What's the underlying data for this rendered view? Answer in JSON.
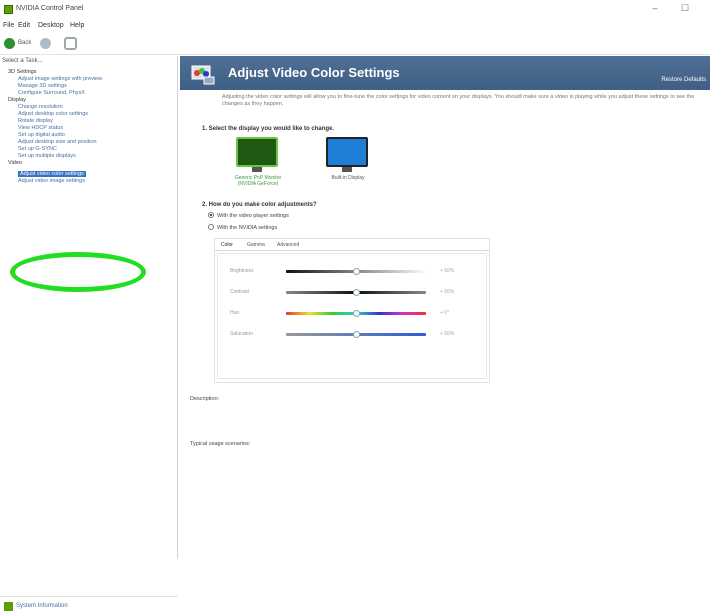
{
  "window": {
    "title": "NVIDIA Control Panel",
    "controls": [
      "–",
      "☐"
    ]
  },
  "menu": [
    "File",
    "Edit",
    "Desktop",
    "Help"
  ],
  "toolbar": {
    "back_label": "Back"
  },
  "sidebar": {
    "header": "Select a Task...",
    "items": [
      {
        "label": "3D Settings",
        "kind": "category"
      },
      {
        "label": "Adjust image settings with preview",
        "kind": "item"
      },
      {
        "label": "Manage 3D settings",
        "kind": "item"
      },
      {
        "label": "Configure Surround, PhysX",
        "kind": "item"
      },
      {
        "label": "Display",
        "kind": "category"
      },
      {
        "label": "Change resolution",
        "kind": "item"
      },
      {
        "label": "Adjust desktop color settings",
        "kind": "item"
      },
      {
        "label": "Rotate display",
        "kind": "item"
      },
      {
        "label": "View HDCP status",
        "kind": "item"
      },
      {
        "label": "Set up digital audio",
        "kind": "item"
      },
      {
        "label": "Adjust desktop size and position",
        "kind": "item"
      },
      {
        "label": "Set up G-SYNC",
        "kind": "item"
      },
      {
        "label": "Set up multiple displays",
        "kind": "item"
      },
      {
        "label": "Video",
        "kind": "category"
      },
      {
        "label": "Adjust video color settings",
        "kind": "selected"
      },
      {
        "label": "Adjust video image settings",
        "kind": "item"
      }
    ],
    "footer": "System Information"
  },
  "main": {
    "title": "Adjust Video Color Settings",
    "link": "Restore Defaults",
    "description": "Adjusting the video color settings will allow you to fine-tune the color settings for video content on your displays. You should make sure a video is playing while you adjust these settings to see the changes as they happen.",
    "step1": "1. Select the display you would like to change.",
    "displays": [
      {
        "label": "Generic PnP Monitor (NVIDIA GeForce)",
        "selected": true,
        "screen_color": "#1f5a12"
      },
      {
        "label": "Built-in Display",
        "selected": false,
        "screen_color": "#1f7fd6"
      }
    ],
    "step2": "2. How do you make color adjustments?",
    "radio_options": [
      {
        "label": "With the video player settings",
        "checked": true
      },
      {
        "label": "With the NVIDIA settings",
        "checked": false
      }
    ],
    "tabs": [
      "Color",
      "Gamma",
      "Advanced"
    ],
    "sliders": [
      {
        "label": "Brightness",
        "value": "+ 50%",
        "fraction": 0.5,
        "gradient": "linear-gradient(90deg,#111,#fafafa)"
      },
      {
        "label": "Contrast",
        "value": "+ 50%",
        "fraction": 0.5,
        "gradient": "linear-gradient(90deg,#888,#111 50%,#888)"
      },
      {
        "label": "Hue",
        "value": "+ 0°",
        "fraction": 0.5,
        "gradient": "linear-gradient(90deg,#e33,#e9e233,#3c3,#3cc,#33c,#c3c,#e33)"
      },
      {
        "label": "Saturation",
        "value": "+ 50%",
        "fraction": 0.5,
        "gradient": "linear-gradient(90deg,#999,#2a5fd6)"
      }
    ],
    "description_label": "Description:",
    "usage_label": "Typical usage scenarios:"
  },
  "colors": {
    "banner": "#46668c",
    "highlight_ring": "#22dd22",
    "selection": "#3a73c4",
    "link": "#4a6fa5"
  }
}
